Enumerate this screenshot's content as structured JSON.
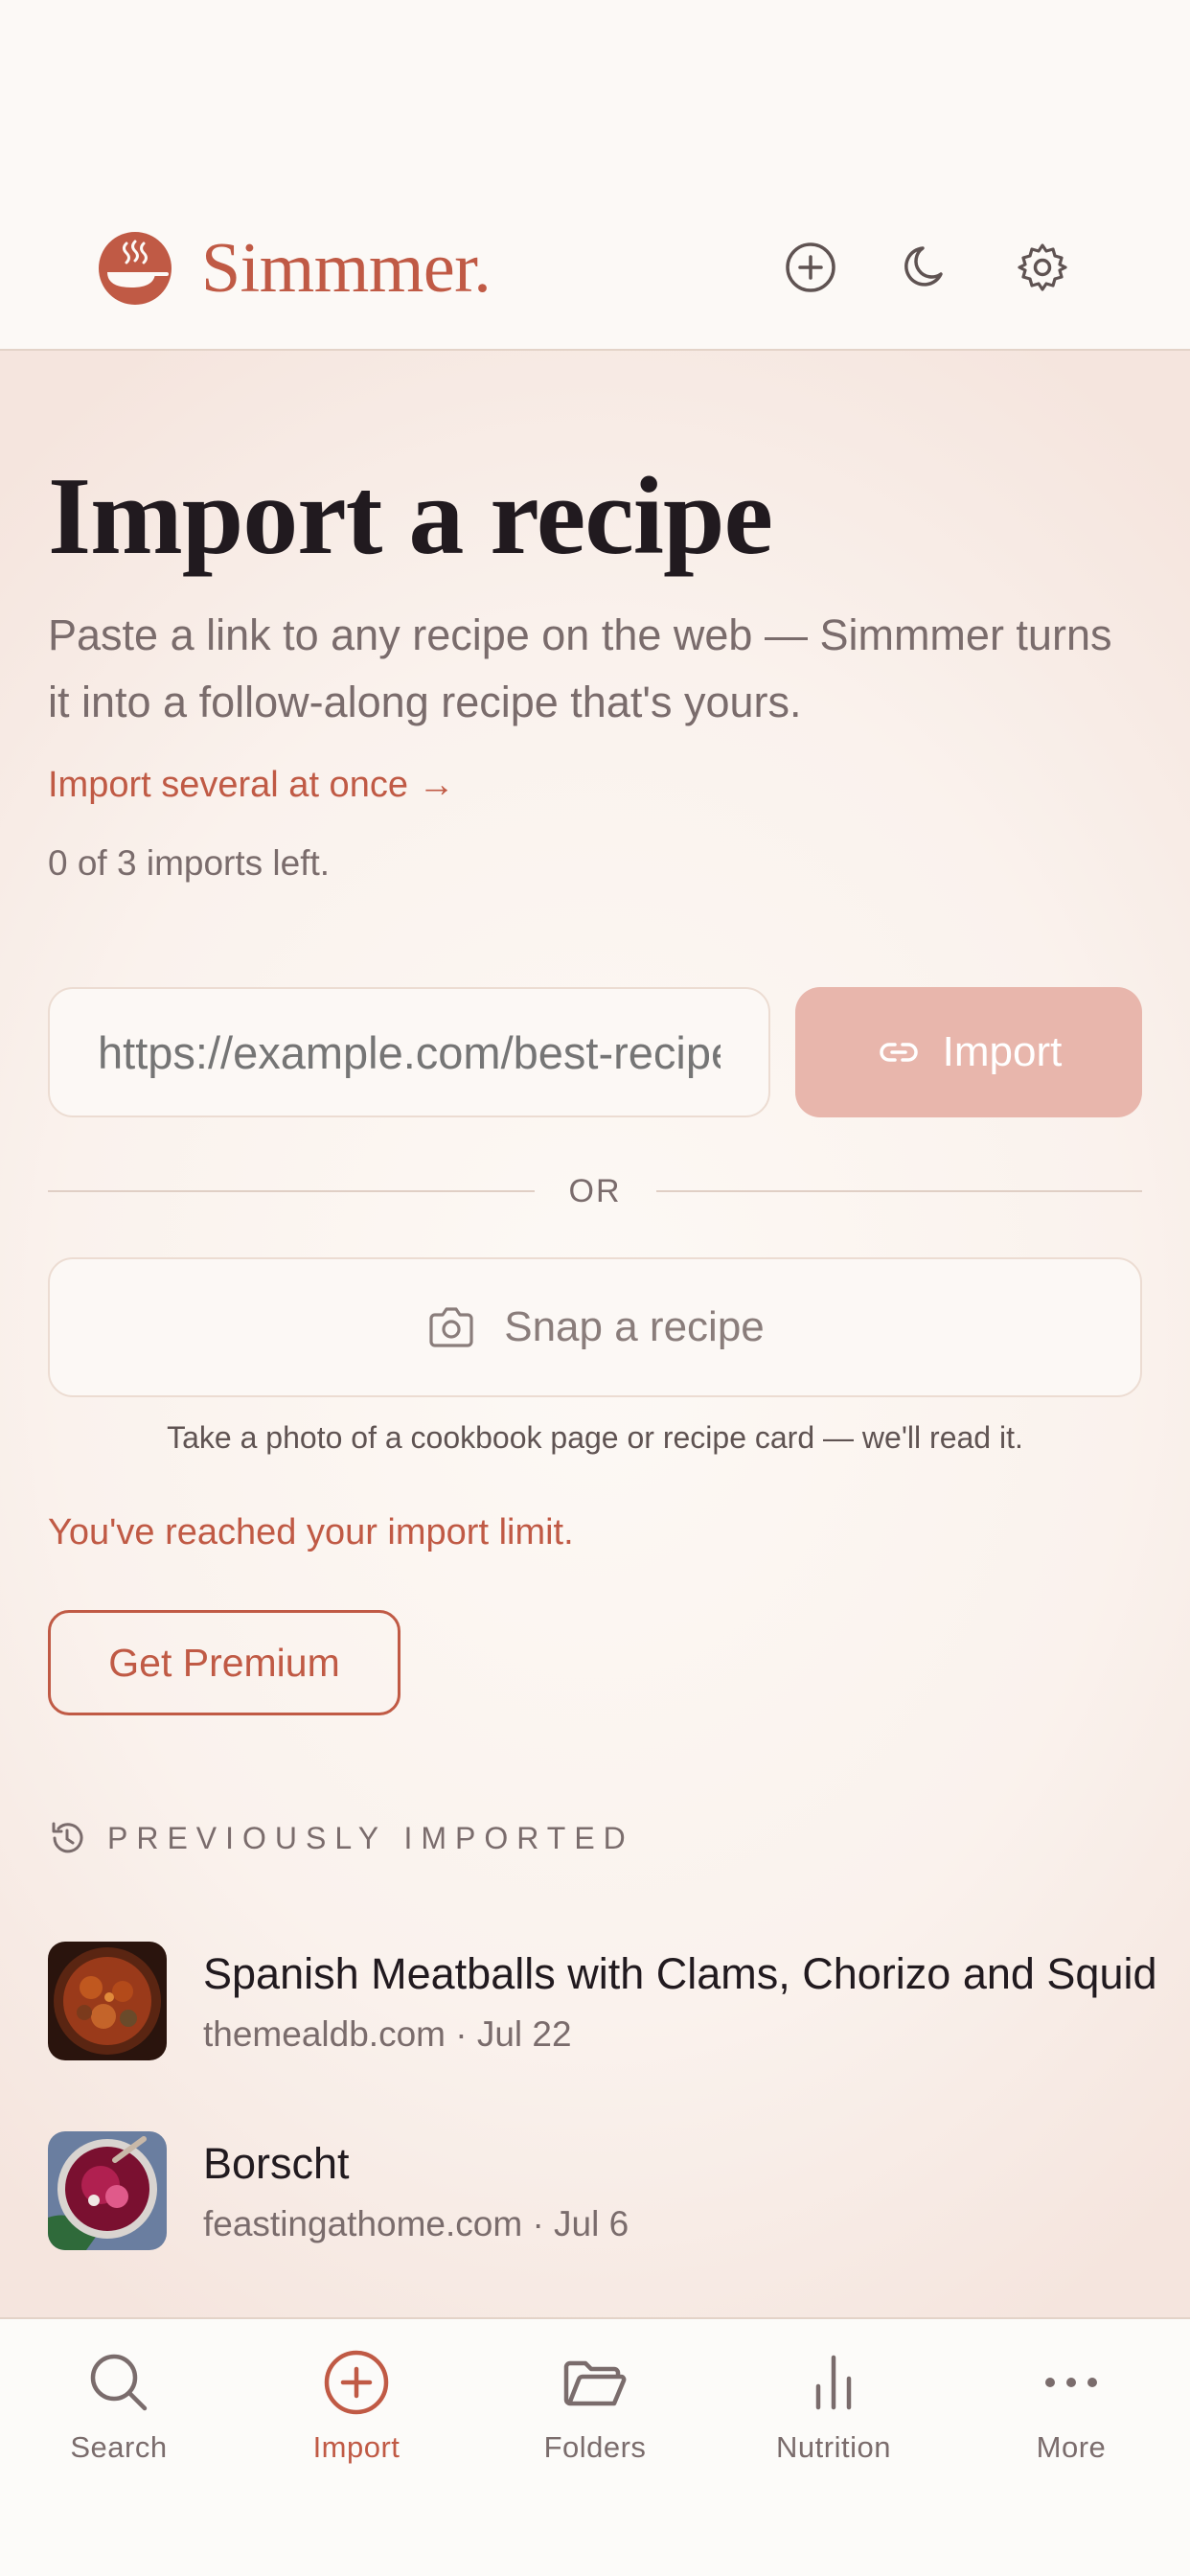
{
  "app": {
    "name": "Simmmer."
  },
  "header": {
    "icons": [
      "plus-circle-icon",
      "moon-icon",
      "gear-icon"
    ]
  },
  "main": {
    "title": "Import a recipe",
    "subtitle": "Paste a link to any recipe on the web — Simmmer turns it into a follow-along recipe that's yours.",
    "import_several_link": "Import several at once →",
    "imports_left": "0 of 3 imports left.",
    "url_input": {
      "placeholder": "https://example.com/best-recipe",
      "value": ""
    },
    "import_button": "Import",
    "or_divider": "OR",
    "snap_button": "Snap a recipe",
    "snap_help": "Take a photo of a cookbook page or recipe card — we'll read it.",
    "limit_message": "You've reached your import limit.",
    "premium_button": "Get Premium",
    "previously_imported": {
      "heading": "PREVIOUSLY IMPORTED",
      "items": [
        {
          "title": "Spanish Meatballs with Clams, Chorizo and Squid",
          "meta": "themealdb.com · Jul 22"
        },
        {
          "title": "Borscht",
          "meta": "feastingathome.com · Jul 6"
        }
      ]
    }
  },
  "tabbar": {
    "active": "Import",
    "tabs": [
      {
        "label": "Search",
        "icon": "search-icon"
      },
      {
        "label": "Import",
        "icon": "plus-circle-icon"
      },
      {
        "label": "Folders",
        "icon": "folder-icon"
      },
      {
        "label": "Nutrition",
        "icon": "bar-chart-icon"
      },
      {
        "label": "More",
        "icon": "more-dots-icon"
      }
    ]
  },
  "colors": {
    "accent": "#c05a45",
    "accent_soft": "#e8b6ac",
    "text_primary": "#211a1f",
    "text_secondary": "#7a6c6c",
    "background": "#fcf9f6"
  }
}
